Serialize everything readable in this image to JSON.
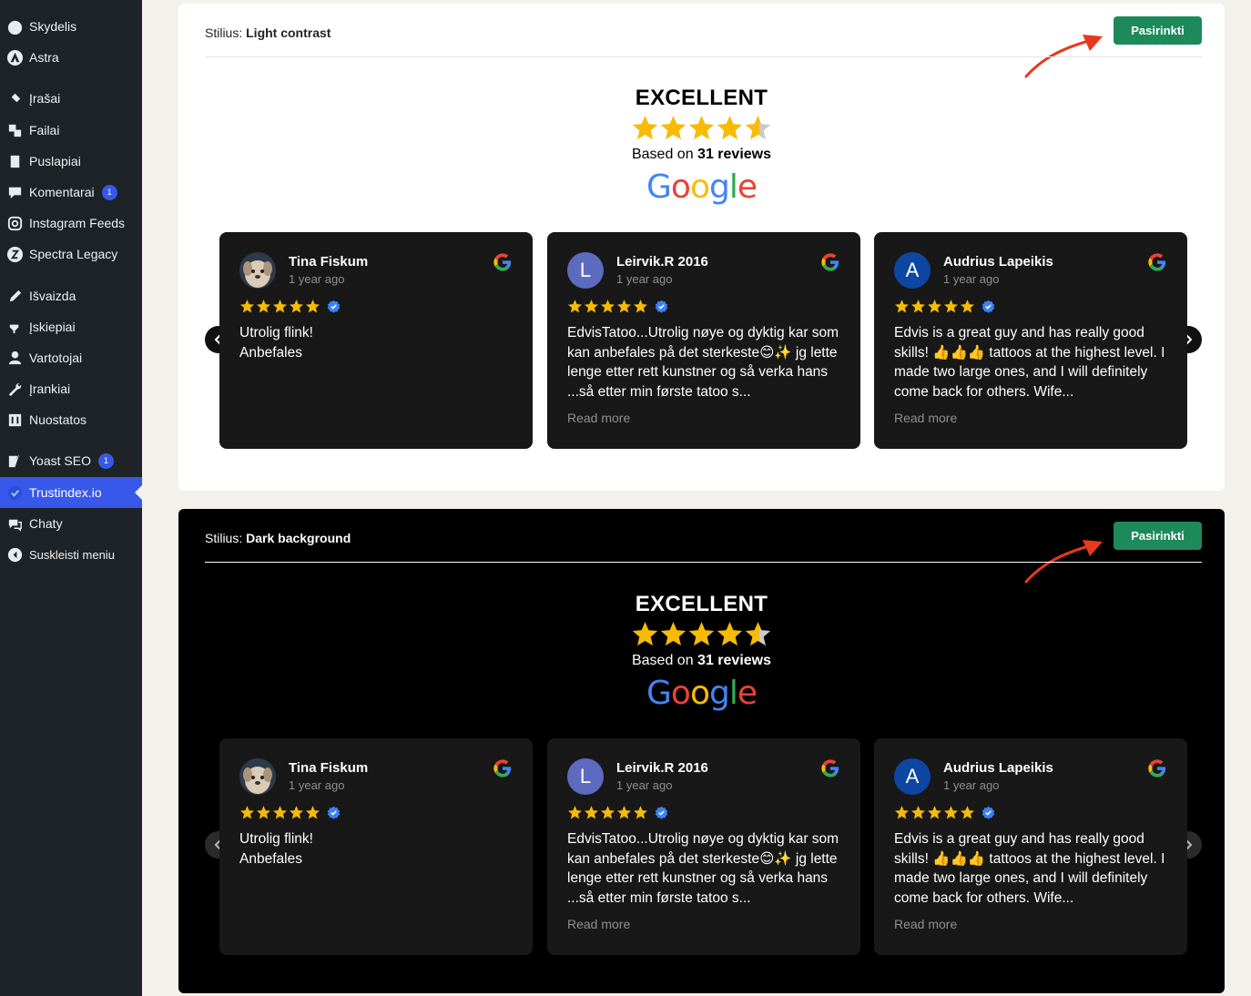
{
  "sidebar": {
    "items": [
      {
        "label": "Skydelis",
        "icon": "dashboard-icon"
      },
      {
        "label": "Astra",
        "icon": "astra-icon"
      },
      {
        "label": "Įrašai",
        "icon": "pin-icon"
      },
      {
        "label": "Failai",
        "icon": "media-icon"
      },
      {
        "label": "Puslapiai",
        "icon": "pages-icon"
      },
      {
        "label": "Komentarai",
        "icon": "comment-icon",
        "badge": "1"
      },
      {
        "label": "Instagram Feeds",
        "icon": "instagram-icon"
      },
      {
        "label": "Spectra Legacy",
        "icon": "spectra-icon"
      },
      {
        "label": "Išvaizda",
        "icon": "appearance-icon"
      },
      {
        "label": "Įskiepiai",
        "icon": "plugins-icon"
      },
      {
        "label": "Vartotojai",
        "icon": "users-icon"
      },
      {
        "label": "Įrankiai",
        "icon": "tools-icon"
      },
      {
        "label": "Nuostatos",
        "icon": "settings-icon"
      },
      {
        "label": "Yoast SEO",
        "icon": "yoast-icon",
        "badge": "1"
      },
      {
        "label": "Trustindex.io",
        "icon": "trustindex-icon",
        "active": true
      },
      {
        "label": "Chaty",
        "icon": "chaty-icon"
      },
      {
        "label": "Suskleisti meniu",
        "icon": "collapse-icon"
      }
    ]
  },
  "styles": [
    {
      "prefix": "Stilius:",
      "name": "Light contrast",
      "button": "Pasirinkti",
      "rating_text": "EXCELLENT",
      "based_on": "Based on",
      "review_count": "31 reviews",
      "google": "Google"
    },
    {
      "prefix": "Stilius:",
      "name": "Dark background",
      "button": "Pasirinkti",
      "rating_text": "EXCELLENT",
      "based_on": "Based on",
      "review_count": "31 reviews",
      "google": "Google"
    }
  ],
  "reviews": [
    {
      "name": "Tina Fiskum",
      "date": "1 year ago",
      "initial": "",
      "avatar": "dog-photo",
      "text": "Utrolig flink!\nAnbefales",
      "read_more": ""
    },
    {
      "name": "Leirvik.R 2016",
      "date": "1 year ago",
      "initial": "L",
      "avatar_color": "#5c6bc0",
      "text": "EdvisTatoo...Utrolig nøye og dyktig kar som kan anbefales på det sterkeste😊✨ jg lette lenge etter rett kunstner og så verka hans ...så etter min første tatoo s...",
      "read_more": "Read more"
    },
    {
      "name": "Audrius Lapeikis",
      "date": "1 year ago",
      "initial": "A",
      "avatar_color": "#0d47a1",
      "text": "Edvis is a great guy and has really good skills! 👍👍👍 tattoos at the highest level. I made two large ones, and I will definitely come back for others. Wife...",
      "read_more": "Read more"
    }
  ],
  "colors": {
    "select_button": "#1d8a5b",
    "sidebar_bg": "#1d2327",
    "active_menu": "#3858e9",
    "star": "#f6bb06",
    "arrow": "#e8391d"
  }
}
